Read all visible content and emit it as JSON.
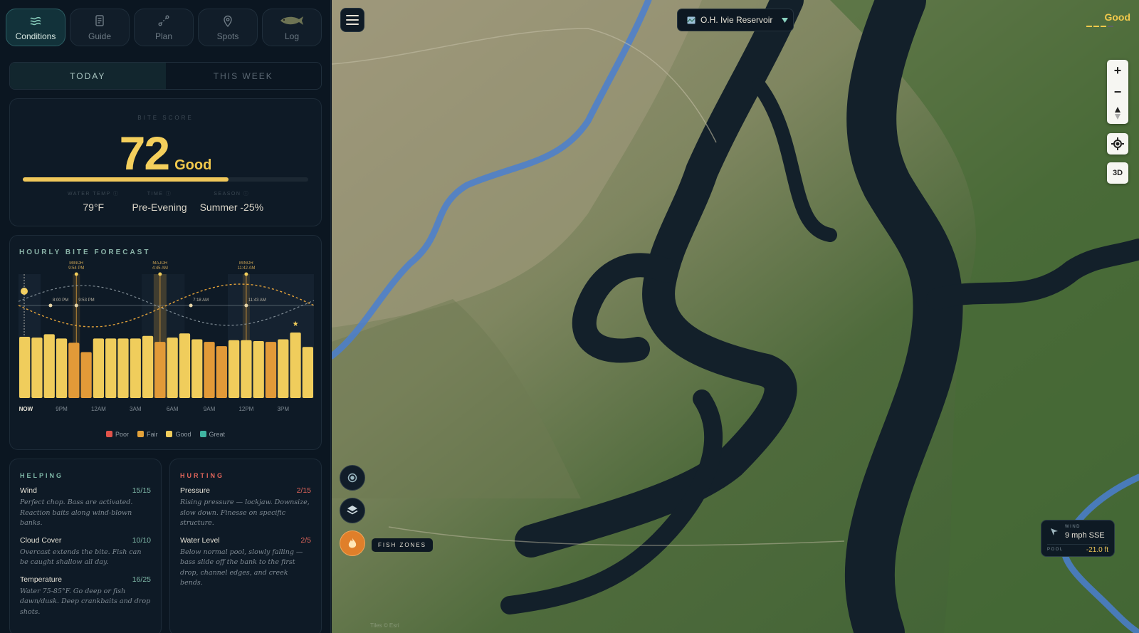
{
  "nav": [
    {
      "label": "Conditions",
      "icon": "waves-icon",
      "active": true
    },
    {
      "label": "Guide",
      "icon": "document-icon",
      "active": false
    },
    {
      "label": "Plan",
      "icon": "route-icon",
      "active": false
    },
    {
      "label": "Spots",
      "icon": "pin-icon",
      "active": false
    },
    {
      "label": "Log",
      "icon": "fish-icon",
      "active": false
    }
  ],
  "tabs": {
    "today": "TODAY",
    "week": "THIS WEEK",
    "selected": "today"
  },
  "score": {
    "heading": "BITE SCORE",
    "value": "72",
    "label": "Good",
    "fraction": 0.72,
    "metrics": [
      {
        "key": "WATER TEMP ⓘ",
        "value": "79°F"
      },
      {
        "key": "TIME ⓘ",
        "value": "Pre-Evening"
      },
      {
        "key": "SEASON ⓘ",
        "value": "Summer -25%"
      }
    ]
  },
  "forecast": {
    "title": "HOURLY BITE FORECAST",
    "legend": [
      {
        "label": "Poor",
        "color": "#e0534a"
      },
      {
        "label": "Fair",
        "color": "#e3a23a"
      },
      {
        "label": "Good",
        "color": "#f0cd5c"
      },
      {
        "label": "Great",
        "color": "#3fb4a1"
      }
    ]
  },
  "chart_data": {
    "type": "bar",
    "x_labels": [
      "NOW",
      "9PM",
      "12AM",
      "3AM",
      "6AM",
      "9AM",
      "12PM",
      "3PM"
    ],
    "hours": 24,
    "values": [
      72,
      71,
      75,
      70,
      65,
      54,
      70,
      70,
      70,
      70,
      73,
      66,
      71,
      76,
      69,
      66,
      61,
      68,
      68,
      67,
      66,
      69,
      77,
      60
    ],
    "categories": [
      "good",
      "good",
      "good",
      "good",
      "fair",
      "fair",
      "good",
      "good",
      "good",
      "good",
      "good",
      "fair",
      "good",
      "good",
      "good",
      "fair",
      "fair",
      "good",
      "good",
      "good",
      "fair",
      "good",
      "good",
      "good"
    ],
    "ylim": [
      0,
      100
    ],
    "solunar": [
      {
        "type": "MINOR",
        "time": "9:54 PM",
        "hour_index": 4.2
      },
      {
        "type": "MAJOR",
        "time": "4:45 AM",
        "hour_index": 11
      },
      {
        "type": "MINOR",
        "time": "11:42 AM",
        "hour_index": 18
      }
    ],
    "sun_events": [
      {
        "time": "8:00 PM",
        "hour_index": 2.1
      },
      {
        "time": "9:53 PM",
        "hour_index": 4.2
      },
      {
        "time": "7:18 AM",
        "hour_index": 13.5
      },
      {
        "time": "11:43 AM",
        "hour_index": 18
      }
    ]
  },
  "helping": {
    "title": "HELPING",
    "items": [
      {
        "name": "Wind",
        "score": "15/15",
        "desc": "Perfect chop. Bass are activated. Reaction baits along wind-blown banks."
      },
      {
        "name": "Cloud Cover",
        "score": "10/10",
        "desc": "Overcast extends the bite. Fish can be caught shallow all day."
      },
      {
        "name": "Temperature",
        "score": "16/25",
        "desc": "Water 75-85°F. Go deep or fish dawn/dusk. Deep crankbaits and drop shots."
      }
    ]
  },
  "hurting": {
    "title": "HURTING",
    "items": [
      {
        "name": "Pressure",
        "score": "2/15",
        "desc": "Rising pressure — lockjaw. Downsize, slow down. Finesse on specific structure."
      },
      {
        "name": "Water Level",
        "score": "2/5",
        "desc": "Below normal pool, slowly falling — bass slide off the bank to the first drop, channel edges, and creek bends."
      }
    ]
  },
  "map": {
    "reservoir": "O.H. Ivie Reservoir",
    "badge": "Good",
    "badge_level": 3,
    "badge_max": 4,
    "controls": {
      "zoom_in": "+",
      "zoom_out": "−",
      "view3d": "3D"
    },
    "fish_zones": "FISH ZONES",
    "wind": {
      "label": "WIND",
      "value": "9 mph SSE"
    },
    "pool": {
      "label": "POOL",
      "value": "-21.0 ft"
    },
    "attribution": "Tiles © Esri"
  },
  "colors": {
    "accent": "#f0c85a",
    "teal": "#8ab3a8",
    "good": "#f2c94c",
    "bad": "#e0534a"
  }
}
